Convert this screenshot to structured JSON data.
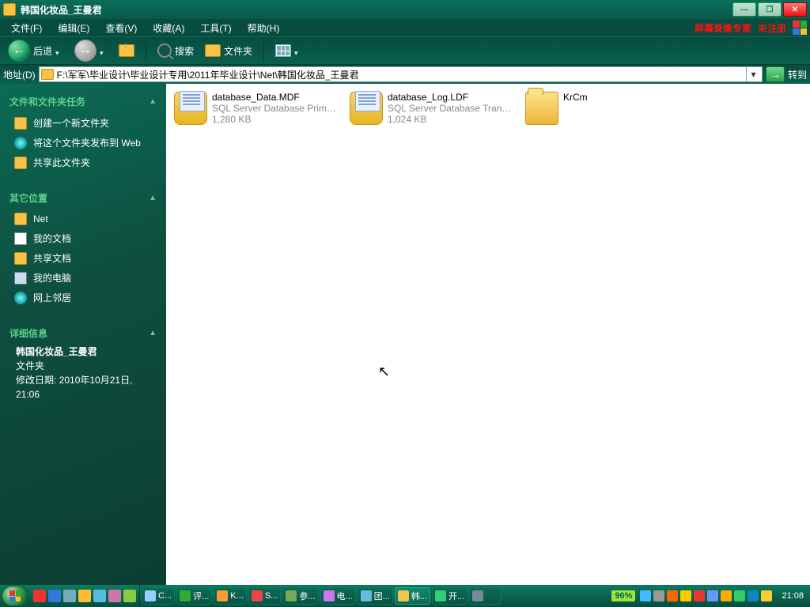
{
  "window": {
    "title": "韩国化妆品_王曼君"
  },
  "menus": {
    "file": "文件(F)",
    "edit": "编辑(E)",
    "view": "查看(V)",
    "fav": "收藏(A)",
    "tools": "工具(T)",
    "help": "帮助(H)",
    "recorder": "屏幕录像专家",
    "unreg": "未注册"
  },
  "toolbar": {
    "back": "后退",
    "search": "搜索",
    "folders": "文件夹"
  },
  "addrbar": {
    "label": "地址(D)",
    "path": "F:\\军军\\毕业设计\\毕业设计专用\\2011年毕业设计\\Net\\韩国化妆品_王曼君",
    "go": "转到"
  },
  "sidebar": {
    "tasks": {
      "header": "文件和文件夹任务",
      "items": [
        "创建一个新文件夹",
        "将这个文件夹发布到 Web",
        "共享此文件夹"
      ]
    },
    "other": {
      "header": "其它位置",
      "items": [
        "Net",
        "我的文档",
        "共享文档",
        "我的电脑",
        "网上邻居"
      ]
    },
    "details": {
      "header": "详细信息",
      "title": "韩国化妆品_王曼君",
      "type": "文件夹",
      "modLabel": "修改日期:",
      "modDate": "2010年10月21日, 21:06"
    }
  },
  "files": [
    {
      "name": "database_Data.MDF",
      "desc": "SQL Server Database Primary ...",
      "size": "1,280 KB",
      "kind": "db"
    },
    {
      "name": "database_Log.LDF",
      "desc": "SQL Server Database Transac...",
      "size": "1,024 KB",
      "kind": "db"
    },
    {
      "name": "KrCm",
      "desc": "",
      "size": "",
      "kind": "fld"
    }
  ],
  "taskbar": {
    "ql_colors": [
      "#e33",
      "#37d",
      "#7ab",
      "#fb3",
      "#5bd",
      "#c7a",
      "#8c4"
    ],
    "tasks": [
      {
        "label": "C...",
        "color": "#9cf"
      },
      {
        "label": "评...",
        "color": "#3a3"
      },
      {
        "label": "K...",
        "color": "#f93"
      },
      {
        "label": "S...",
        "color": "#e44"
      },
      {
        "label": "参...",
        "color": "#7a5"
      },
      {
        "label": "电...",
        "color": "#c7e"
      },
      {
        "label": "团...",
        "color": "#6bd"
      },
      {
        "label": "韩...",
        "color": "#f7c24a",
        "active": true
      },
      {
        "label": "开...",
        "color": "#3c7"
      },
      {
        "label": "",
        "color": "#789"
      }
    ],
    "battery": "96%",
    "tray_colors": [
      "#4bf",
      "#999",
      "#f60",
      "#fc0",
      "#e33",
      "#69f",
      "#fa0",
      "#3c6",
      "#18b",
      "#fc3"
    ],
    "clock": "21:08"
  }
}
